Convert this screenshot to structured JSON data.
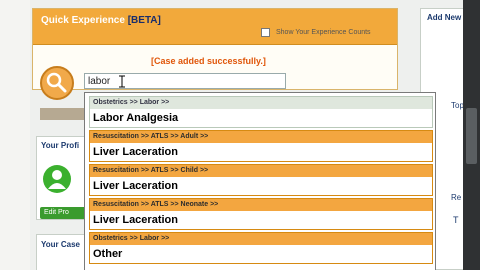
{
  "quick_experience": {
    "title": "Quick Experience",
    "beta": "[BETA]",
    "show_counts_label": "Show Your Experience Counts",
    "success_message": "[Case added successfully.]",
    "search_value": "labor"
  },
  "profile_panel": {
    "title": "Your Profi",
    "edit_button": "Edit Pro"
  },
  "cases_panel": {
    "title": "Your Case"
  },
  "right_panel": {
    "add_new": "Add New",
    "top_fragment": "Top",
    "re_fragment": "Re",
    "t_fragment": "T"
  },
  "dropdown": {
    "items": [
      {
        "path": "Obstetrics >> Labor >>",
        "name": "Labor Analgesia"
      },
      {
        "path": "Resuscitation >> ATLS >> Adult >>",
        "name": "Liver Laceration"
      },
      {
        "path": "Resuscitation >> ATLS >> Child >>",
        "name": "Liver Laceration"
      },
      {
        "path": "Resuscitation >> ATLS >> Neonate >>",
        "name": "Liver Laceration"
      },
      {
        "path": "Obstetrics >> Labor >>",
        "name": "Other"
      }
    ]
  }
}
